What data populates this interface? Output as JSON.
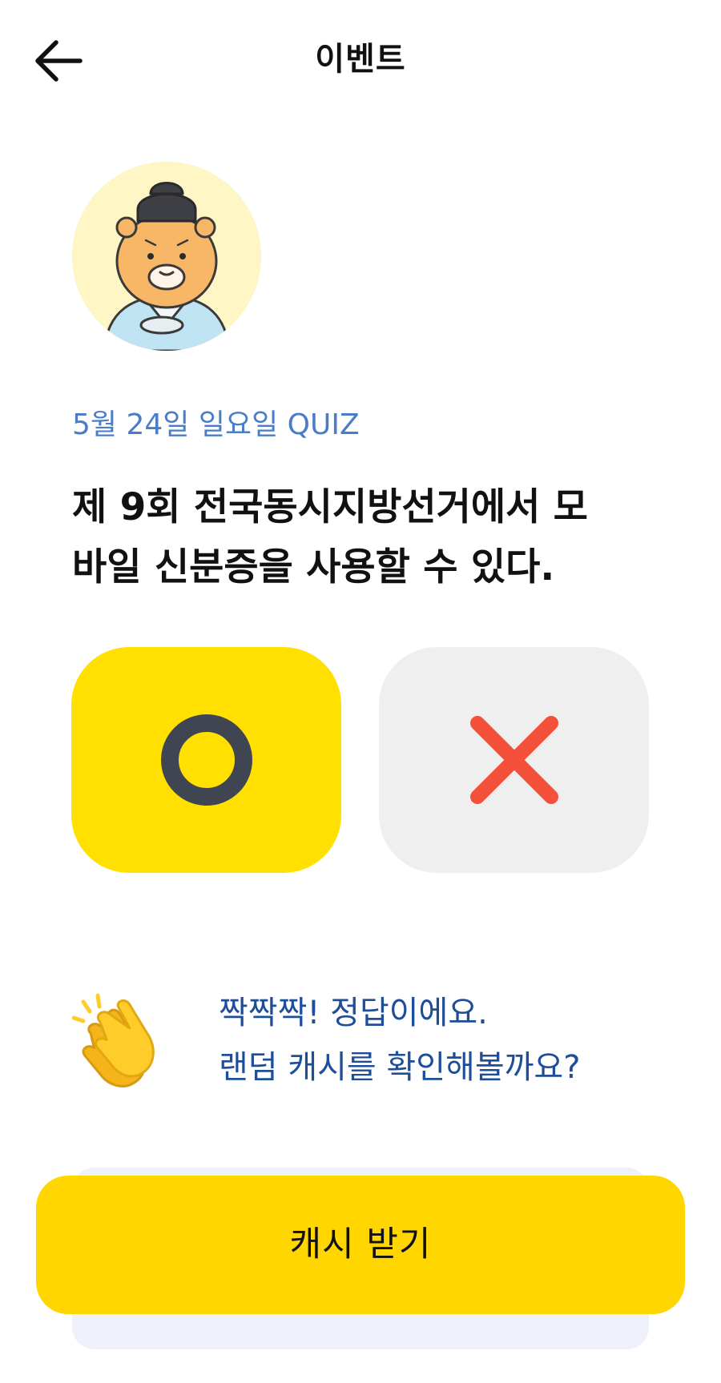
{
  "header": {
    "title": "이벤트",
    "back_icon": "arrow-left-icon"
  },
  "avatar": {
    "icon": "character-avatar"
  },
  "quiz": {
    "date_label": "5월 24일 일요일 QUIZ",
    "question_line1": "제 9회 전국동시지방선거에서 모",
    "question_line2": "바일 신분증을 사용할 수 있다."
  },
  "options": {
    "o": {
      "icon": "circle-o-icon",
      "color": "#ffe000",
      "selected": true
    },
    "x": {
      "icon": "x-cross-icon",
      "color": "#efefef",
      "selected": false
    }
  },
  "result": {
    "icon": "clapping-hands-icon",
    "line1": "짝짝짝! 정답이에요.",
    "line2": "랜덤 캐시를 확인해볼까요?"
  },
  "cta": {
    "label": "캐시 받기",
    "color": "#ffd600"
  },
  "colors": {
    "accent_yellow": "#ffe000",
    "date_blue": "#4a7cc8",
    "result_blue": "#1f4e98",
    "x_red": "#f5503a",
    "o_dark": "#404552"
  }
}
